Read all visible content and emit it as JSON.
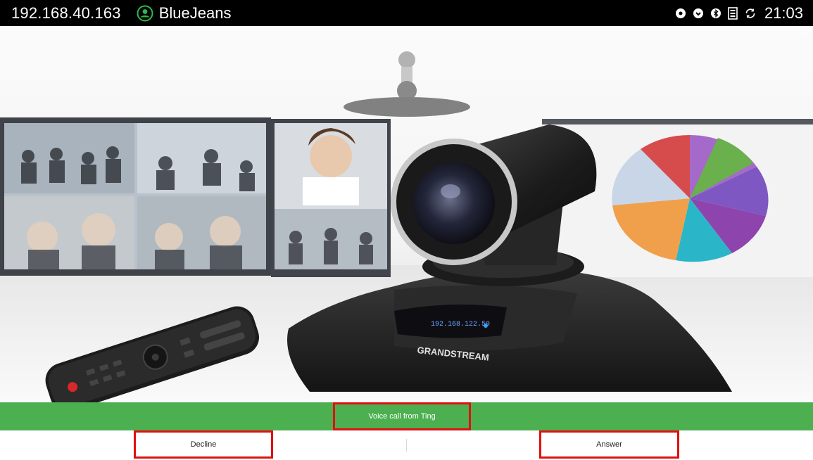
{
  "status_bar": {
    "ip_address": "192.168.40.163",
    "account_name": "BlueJeans",
    "time": "21:03",
    "icons": [
      "notification-icon",
      "chat-icon",
      "bluetooth-icon",
      "sim-card-icon",
      "sync-icon"
    ],
    "account_icon": "account-icon",
    "account_icon_color": "#2eb84b"
  },
  "wallpaper": {
    "device_display_ip": "192.168.122.50",
    "brand_text": "GRANDSTREAM"
  },
  "incoming_call": {
    "message": "Voice call from Ting",
    "bar_color": "#4caf50"
  },
  "actions": {
    "decline_label": "Decline",
    "answer_label": "Answer"
  }
}
